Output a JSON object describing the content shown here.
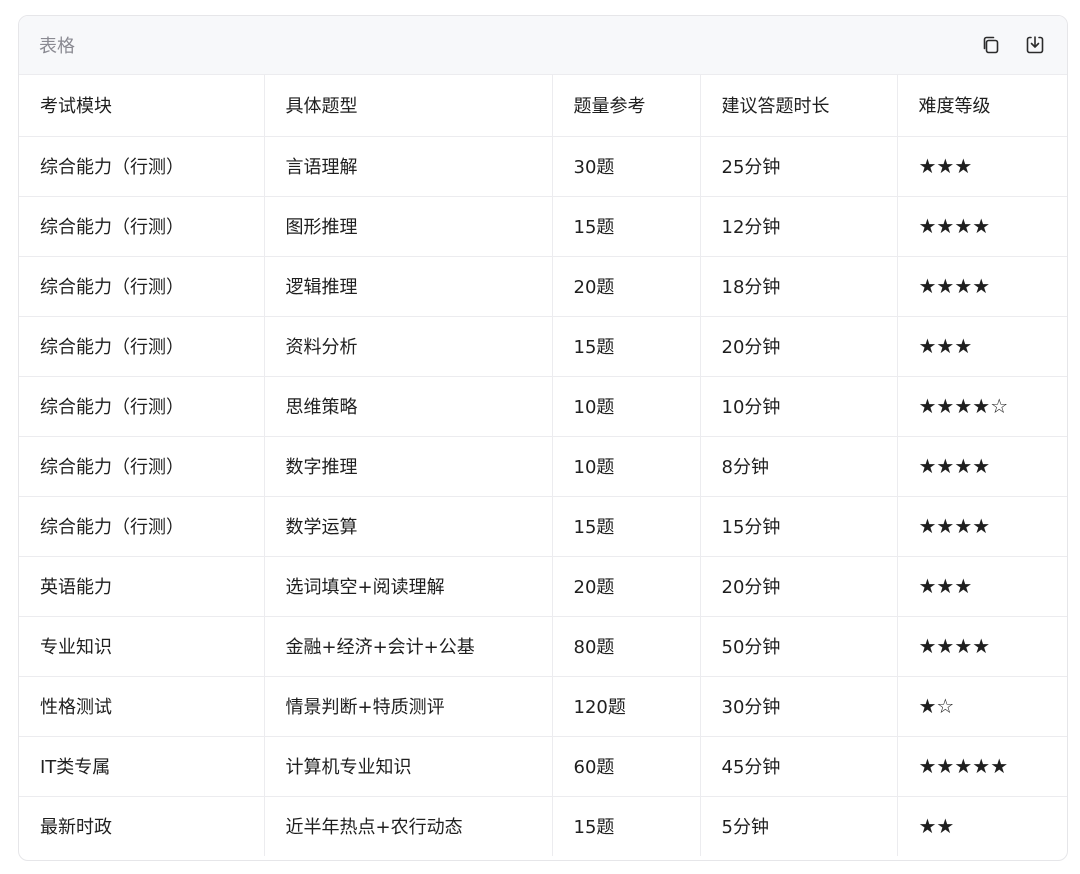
{
  "card": {
    "title": "表格",
    "copy_icon": "copy-icon",
    "download_icon": "download-icon"
  },
  "table": {
    "headers": [
      "考试模块",
      "具体题型",
      "题量参考",
      "建议答题时长",
      "难度等级"
    ],
    "rows": [
      [
        "综合能力（行测）",
        "言语理解",
        "30题",
        "25分钟",
        "★★★"
      ],
      [
        "综合能力（行测）",
        "图形推理",
        "15题",
        "12分钟",
        "★★★★"
      ],
      [
        "综合能力（行测）",
        "逻辑推理",
        "20题",
        "18分钟",
        "★★★★"
      ],
      [
        "综合能力（行测）",
        "资料分析",
        "15题",
        "20分钟",
        "★★★"
      ],
      [
        "综合能力（行测）",
        "思维策略",
        "10题",
        "10分钟",
        "★★★★☆"
      ],
      [
        "综合能力（行测）",
        "数字推理",
        "10题",
        "8分钟",
        "★★★★"
      ],
      [
        "综合能力（行测）",
        "数学运算",
        "15题",
        "15分钟",
        "★★★★"
      ],
      [
        "英语能力",
        "选词填空+阅读理解",
        "20题",
        "20分钟",
        "★★★"
      ],
      [
        "专业知识",
        "金融+经济+会计+公基",
        "80题",
        "50分钟",
        "★★★★"
      ],
      [
        "性格测试",
        "情景判断+特质测评",
        "120题",
        "30分钟",
        "★☆"
      ],
      [
        "IT类专属",
        "计算机专业知识",
        "60题",
        "45分钟",
        "★★★★★"
      ],
      [
        "最新时政",
        "近半年热点+农行动态",
        "15题",
        "5分钟",
        "★★"
      ]
    ]
  }
}
